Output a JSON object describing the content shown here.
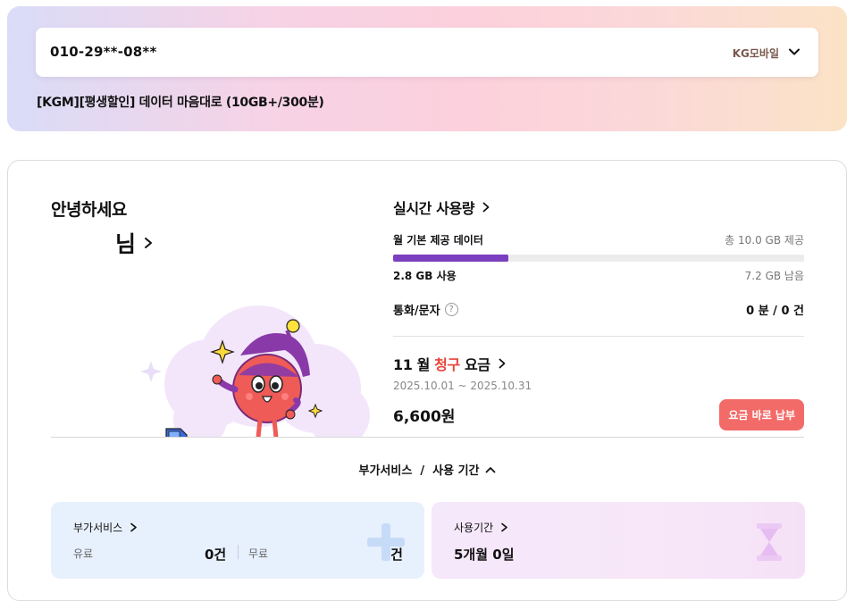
{
  "line": {
    "phone": "010-29**-08**",
    "carrier": "KG모바일",
    "plan": "[KGM][평생할인] 데이터 마음대로 (10GB+/300분)"
  },
  "greeting": {
    "hello": "안녕하세요",
    "name": "님"
  },
  "usage": {
    "title": "실시간 사용량",
    "data_label": "월 기본 제공 데이터",
    "data_total": "총 10.0 GB 제공",
    "data_used": "2.8 GB 사용",
    "data_left": "7.2 GB 남음",
    "data_used_fraction": 0.28,
    "call_label": "통화/문자",
    "call_help": "?",
    "call_value": "0 분 / 0 건"
  },
  "bill": {
    "month": "11 월",
    "type": "청구",
    "suffix": "요금",
    "period": "2025.10.01 ~ 2025.10.31",
    "amount": "6,600원",
    "pay_button": "요금 바로 납부"
  },
  "toggle": {
    "label": "부가서비스  /  사용 기간"
  },
  "addon": {
    "title": "부가서비스",
    "paid_label": "유료",
    "paid_value": "0건",
    "free_label": "무료",
    "free_value": "6건"
  },
  "period": {
    "title": "사용기간",
    "value": "5개월 0일"
  },
  "colors": {
    "accent_purple": "#7b3fbf",
    "bill_red": "#e8433a",
    "pay_button": "#f36b68"
  }
}
